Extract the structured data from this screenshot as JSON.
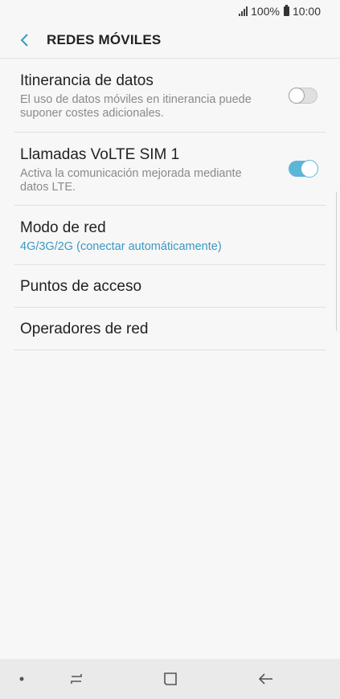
{
  "status": {
    "battery": "100%",
    "time": "10:00"
  },
  "header": {
    "title": "REDES MÓVILES"
  },
  "items": [
    {
      "title": "Itinerancia de datos",
      "desc": "El uso de datos móviles en itinerancia puede suponer costes adicionales.",
      "toggle": "off"
    },
    {
      "title": "Llamadas VoLTE SIM 1",
      "desc": "Activa la comunicación mejorada mediante datos LTE.",
      "toggle": "on"
    },
    {
      "title": "Modo de red",
      "sub": "4G/3G/2G (conectar automáticamente)"
    },
    {
      "title": "Puntos de acceso"
    },
    {
      "title": "Operadores de red"
    }
  ],
  "navbar": {
    "icons": [
      "dot-icon",
      "recent-apps-icon",
      "home-icon",
      "back-arrow-icon"
    ]
  },
  "colors": {
    "accent": "#3a9ac2",
    "toggle_on": "#5cb6d8",
    "background": "#f7f7f7",
    "navbar": "#eaeaea"
  }
}
